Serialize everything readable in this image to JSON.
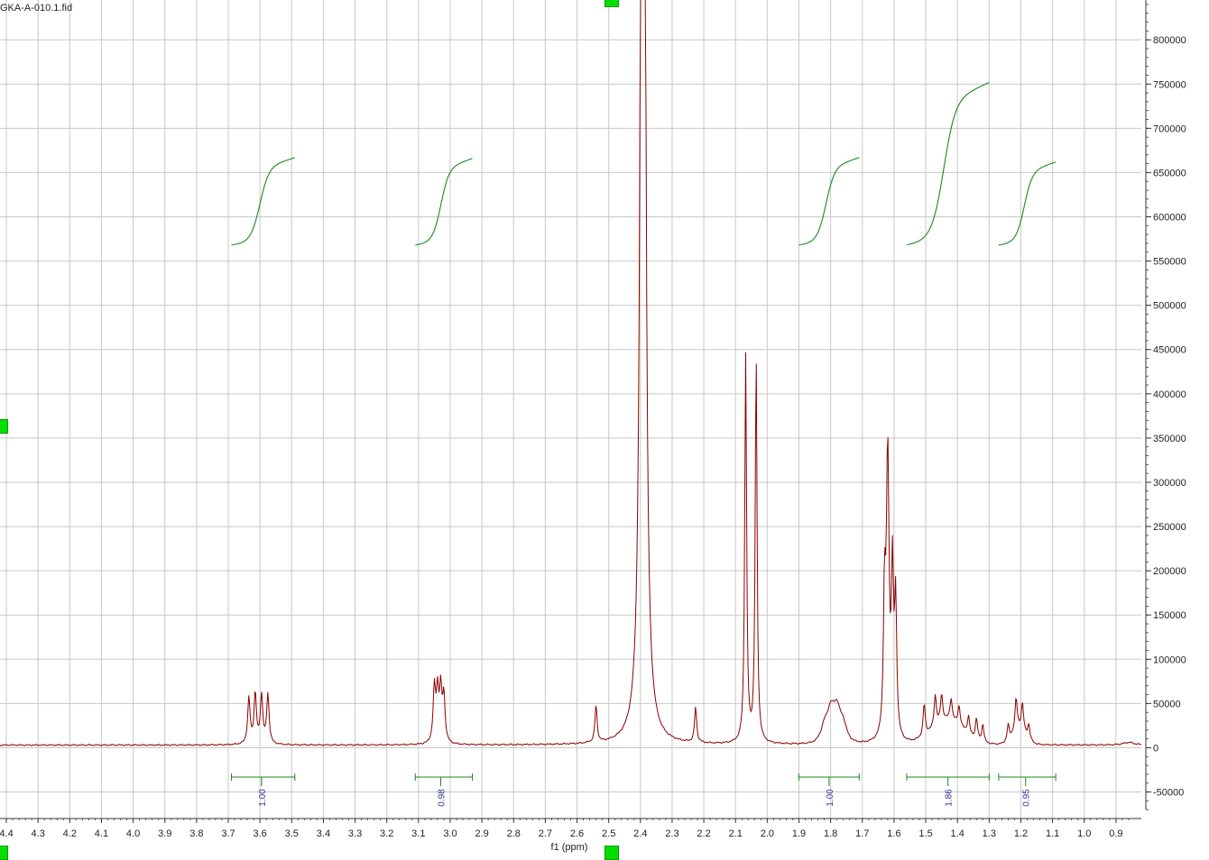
{
  "colors": {
    "spectrum": "#8b0000",
    "integral": "#1a8a1a",
    "integral_label": "#333399",
    "grid": "#c8c8c8",
    "axis": "#333333",
    "handle": "#00e000"
  },
  "chart_data": {
    "type": "line",
    "title": "GKA-A-010.1.fid",
    "xlabel": "f1 (ppm)",
    "ylabel": "",
    "x_reversed": true,
    "xlim": [
      4.42,
      0.82
    ],
    "ylim": [
      -80000,
      845000
    ],
    "grid": true,
    "x_ticks": [
      4.4,
      4.3,
      4.2,
      4.1,
      4.0,
      3.9,
      3.8,
      3.7,
      3.6,
      3.5,
      3.4,
      3.3,
      3.2,
      3.1,
      3.0,
      2.9,
      2.8,
      2.7,
      2.6,
      2.5,
      2.4,
      2.3,
      2.2,
      2.1,
      2.0,
      1.9,
      1.8,
      1.7,
      1.6,
      1.5,
      1.4,
      1.3,
      1.2,
      1.1,
      1.0,
      0.9
    ],
    "x_tick_labels": [
      "4.4",
      "4.3",
      "4.2",
      "4.1",
      "4.0",
      "3.9",
      "3.8",
      "3.7",
      "3.6",
      "3.5",
      "3.4",
      "3.3",
      "3.2",
      "3.1",
      "3.0",
      "2.9",
      "2.8",
      "2.7",
      "2.6",
      "2.5",
      "2.4",
      "2.3",
      "2.2",
      "2.1",
      "2.0",
      "1.9",
      "1.8",
      "1.7",
      "1.6",
      "1.5",
      "1.4",
      "1.3",
      "1.2",
      "1.1",
      "1.0",
      "0.9"
    ],
    "y_ticks": [
      -50000,
      0,
      50000,
      100000,
      150000,
      200000,
      250000,
      300000,
      350000,
      400000,
      450000,
      500000,
      550000,
      600000,
      650000,
      700000,
      750000,
      800000
    ],
    "y_tick_labels": [
      "-50000",
      "0",
      "50000",
      "100000",
      "150000",
      "200000",
      "250000",
      "300000",
      "350000",
      "400000",
      "450000",
      "500000",
      "550000",
      "600000",
      "650000",
      "700000",
      "750000",
      "800000"
    ],
    "baseline": 3000,
    "peaks": [
      {
        "ppm": 3.635,
        "height": 52000,
        "width": 0.0045
      },
      {
        "ppm": 3.615,
        "height": 57000,
        "width": 0.0045
      },
      {
        "ppm": 3.595,
        "height": 55000,
        "width": 0.0045
      },
      {
        "ppm": 3.575,
        "height": 56000,
        "width": 0.0045
      },
      {
        "ppm": 3.05,
        "height": 61000,
        "width": 0.0045
      },
      {
        "ppm": 3.04,
        "height": 55000,
        "width": 0.0045
      },
      {
        "ppm": 3.03,
        "height": 58000,
        "width": 0.0045
      },
      {
        "ppm": 3.02,
        "height": 52000,
        "width": 0.0045
      },
      {
        "ppm": 2.54,
        "height": 42000,
        "width": 0.004
      },
      {
        "ppm": 2.392,
        "height": 4000000,
        "width": 0.0045
      },
      {
        "ppm": 2.226,
        "height": 40000,
        "width": 0.004
      },
      {
        "ppm": 2.068,
        "height": 438000,
        "width": 0.0035
      },
      {
        "ppm": 2.035,
        "height": 437000,
        "width": 0.0035
      },
      {
        "ppm": 1.82,
        "height": 12000,
        "width": 0.012
      },
      {
        "ppm": 1.8,
        "height": 20000,
        "width": 0.012
      },
      {
        "ppm": 1.78,
        "height": 22000,
        "width": 0.012
      },
      {
        "ppm": 1.76,
        "height": 14000,
        "width": 0.012
      },
      {
        "ppm": 1.63,
        "height": 150000,
        "width": 0.004
      },
      {
        "ppm": 1.62,
        "height": 320000,
        "width": 0.005
      },
      {
        "ppm": 1.605,
        "height": 180000,
        "width": 0.004
      },
      {
        "ppm": 1.595,
        "height": 150000,
        "width": 0.004
      },
      {
        "ppm": 1.505,
        "height": 36000,
        "width": 0.004
      },
      {
        "ppm": 1.47,
        "height": 35000,
        "width": 0.004
      },
      {
        "ppm": 1.45,
        "height": 30000,
        "width": 0.004
      },
      {
        "ppm": 1.42,
        "height": 24000,
        "width": 0.004
      },
      {
        "ppm": 1.395,
        "height": 22000,
        "width": 0.004
      },
      {
        "ppm": 1.365,
        "height": 20000,
        "width": 0.004
      },
      {
        "ppm": 1.34,
        "height": 24000,
        "width": 0.004
      },
      {
        "ppm": 1.32,
        "height": 20000,
        "width": 0.004
      },
      {
        "ppm": 1.24,
        "height": 18000,
        "width": 0.004
      },
      {
        "ppm": 1.215,
        "height": 36000,
        "width": 0.004
      },
      {
        "ppm": 1.195,
        "height": 30000,
        "width": 0.004
      },
      {
        "ppm": 1.175,
        "height": 16000,
        "width": 0.004
      },
      {
        "ppm": 0.86,
        "height": 3000,
        "width": 0.02
      }
    ],
    "integrals": [
      {
        "from": 3.69,
        "to": 3.49,
        "center": 3.595,
        "label": "1.00",
        "curve_y": [
          568000,
          585000,
          655000,
          667000
        ]
      },
      {
        "from": 3.11,
        "to": 2.93,
        "center": 3.03,
        "label": "0.98",
        "curve_y": [
          568000,
          580000,
          655000,
          666000
        ]
      },
      {
        "from": 1.9,
        "to": 1.71,
        "center": 1.805,
        "label": "1.00",
        "curve_y": [
          568000,
          580000,
          650000,
          667000
        ]
      },
      {
        "from": 1.56,
        "to": 1.3,
        "center": 1.43,
        "label": "1.86",
        "curve_y": [
          568000,
          580000,
          700000,
          752000
        ]
      },
      {
        "from": 1.27,
        "to": 1.09,
        "center": 1.185,
        "label": "0.95",
        "curve_y": [
          568000,
          575000,
          650000,
          662000
        ]
      }
    ]
  }
}
